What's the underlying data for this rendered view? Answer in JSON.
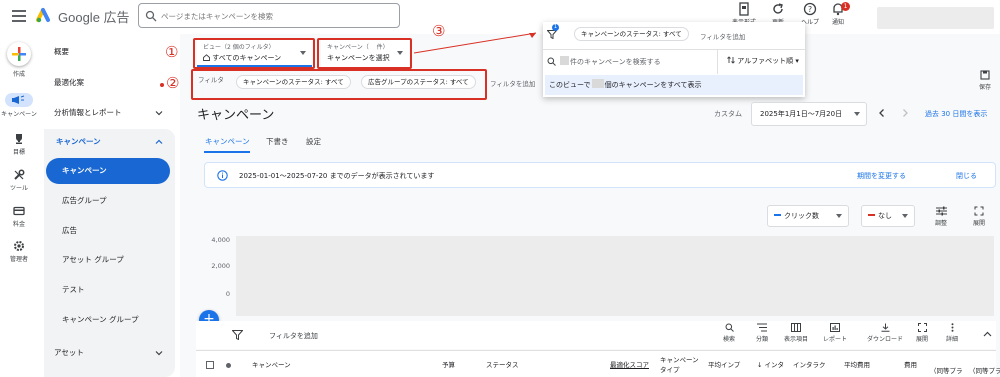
{
  "header": {
    "brand": "Google 広告",
    "search_placeholder": "ページまたはキャンペーンを検索",
    "icons": [
      {
        "name": "display-format-icon",
        "label": "表示形式"
      },
      {
        "name": "refresh-icon",
        "label": "更新"
      },
      {
        "name": "help-icon",
        "label": "ヘルプ"
      },
      {
        "name": "notification-icon",
        "label": "通知",
        "badge": "1"
      }
    ]
  },
  "rail": {
    "items": [
      {
        "name": "create",
        "label": "作成"
      },
      {
        "name": "campaigns",
        "label": "キャンペーン"
      },
      {
        "name": "goals",
        "label": "目標"
      },
      {
        "name": "tools",
        "label": "ツール"
      },
      {
        "name": "billing",
        "label": "料金"
      },
      {
        "name": "admin",
        "label": "管理者"
      }
    ]
  },
  "nav": {
    "overview": "概要",
    "recommendations": "最適化案",
    "insights": "分析情報とレポート",
    "campaigns_group": "キャンペーン",
    "sub_items": [
      "キャンペーン",
      "広告グループ",
      "広告",
      "アセット グループ",
      "テスト",
      "キャンペーン グループ"
    ],
    "assets": "アセット"
  },
  "view_selector": {
    "label": "ビュー（2 個のフィルタ）",
    "value": "すべてのキャンペーン"
  },
  "campaign_selector": {
    "label": "キャンペーン（　 件）",
    "value": "キャンペーンを選択"
  },
  "annotations": {
    "one": "①",
    "two": "②",
    "three": "③"
  },
  "filter_bar": {
    "label": "フィルタ",
    "chips": [
      "キャンペーンのステータス: すべて",
      "広告グループのステータス: すべて"
    ],
    "add_filter": "フィルタを追加"
  },
  "popup": {
    "filter_badge": "1",
    "chip": "キャンペーンのステータス: すべて",
    "add_filter": "フィルタを追加",
    "search_placeholder_suffix": "件のキャンペーンを検索する",
    "sort_label": "アルファベット順",
    "show_all_prefix": "このビューで",
    "show_all_suffix": "個のキャンペーンをすべて表示"
  },
  "save_label": "保存",
  "page": {
    "title": "キャンペーン",
    "custom_label": "カスタム",
    "date_range": "2025年1月1日〜7月20日",
    "period_link": "過去 30 日間を表示"
  },
  "tabs": [
    "キャンペーン",
    "下書き",
    "設定"
  ],
  "banner": {
    "text": "2025-01-01～2025-07-20 までのデータが表示されています",
    "change_period": "期間を変更する",
    "close": "閉じる"
  },
  "chart_controls": {
    "metric1": "クリック数",
    "metric1_color": "#1a73e8",
    "metric2": "なし",
    "metric2_color": "#d93025",
    "adjust": "調整",
    "expand": "展開"
  },
  "chart_data": {
    "type": "line",
    "title": "",
    "xlabel": "",
    "ylabel": "",
    "y_ticks": [
      "4,000",
      "2,000",
      "0"
    ],
    "ylim": [
      0,
      4000
    ],
    "series": []
  },
  "table_toolbar": {
    "filter_add": "フィルタを追加",
    "tools": [
      "検索",
      "分類",
      "表示項目",
      "レポート",
      "ダウンロード",
      "展開",
      "詳細"
    ]
  },
  "table_headers": [
    "キャンペーン",
    "予算",
    "ステータス",
    "最適化スコア",
    "キャンペーン タイプ",
    "平均インプ",
    "↓ インタ",
    "インタラク",
    "平均費用",
    "費用",
    "（同等プラ",
    "（同等プラ"
  ]
}
